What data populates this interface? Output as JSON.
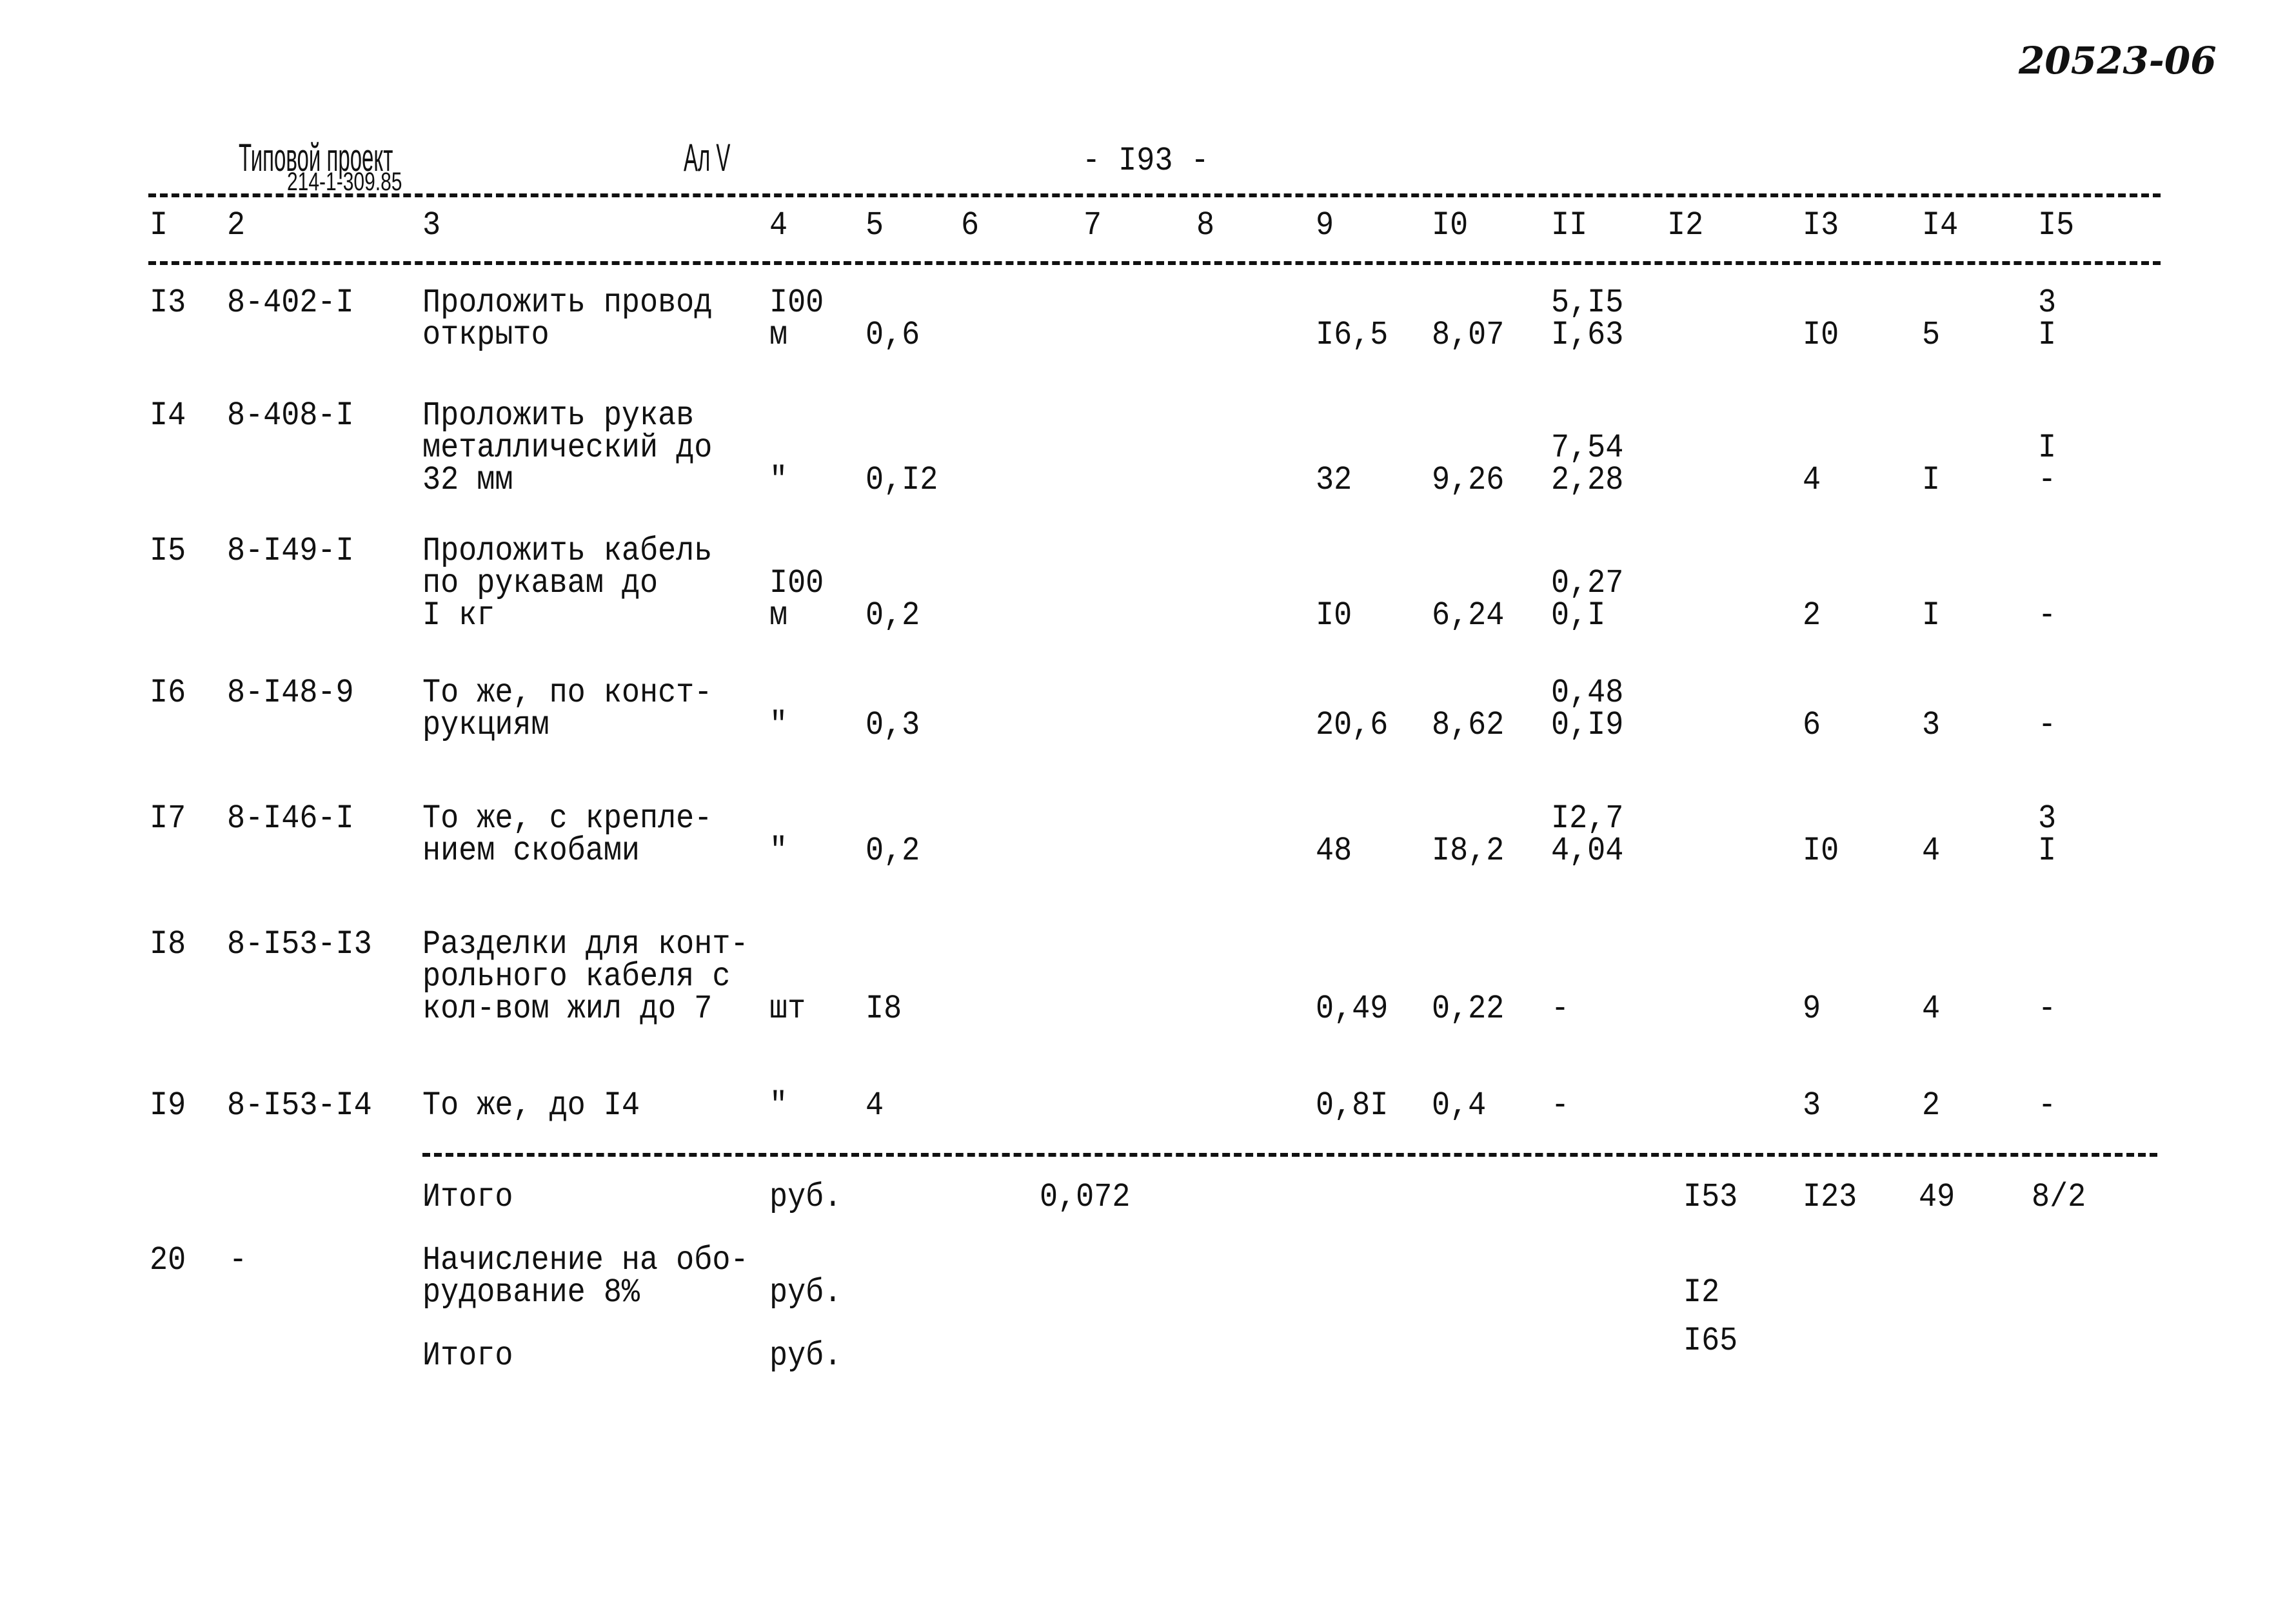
{
  "header": {
    "archive_number": "20523-06",
    "project_label": "Типовой проект",
    "project_number": "214-1-309.85",
    "album": "Ал V",
    "page": "- I93 -"
  },
  "columns": [
    "I",
    "2",
    "3",
    "4",
    "5",
    "6",
    "7",
    "8",
    "9",
    "I0",
    "II",
    "I2",
    "I3",
    "I4",
    "I5"
  ],
  "rows": [
    {
      "num": "I3",
      "code": "8-402-I",
      "desc": "Проложить провод\nоткрыто",
      "unit": "I00\nм",
      "qty": "0,6",
      "c9": "I6,5",
      "c10": "8,07",
      "c11": "5,I5\nI,63",
      "c13": "I0",
      "c14": "5",
      "c15": "3\nI"
    },
    {
      "num": "I4",
      "code": "8-408-I",
      "desc": "Проложить рукав\nметаллический до\n32 мм",
      "unit": "\"",
      "qty": "0,I2",
      "c9": "32",
      "c10": "9,26",
      "c11": "7,54\n2,28",
      "c13": "4",
      "c14": "I",
      "c15": "I\n-"
    },
    {
      "num": "I5",
      "code": "8-I49-I",
      "desc": "Проложить кабель\nпо рукавам до\nI кг",
      "unit": "I00\nм",
      "qty": "0,2",
      "c9": "I0",
      "c10": "6,24",
      "c11": "0,27\n0,I",
      "c13": "2",
      "c14": "I",
      "c15": "-"
    },
    {
      "num": "I6",
      "code": "8-I48-9",
      "desc": "То же, по конст-\nрукциям",
      "unit": "\"",
      "qty": "0,3",
      "c9": "20,6",
      "c10": "8,62",
      "c11": "0,48\n0,I9",
      "c13": "6",
      "c14": "3",
      "c15": "-"
    },
    {
      "num": "I7",
      "code": "8-I46-I",
      "desc": "То же, с крепле-\nнием скобами",
      "unit": "\"",
      "qty": "0,2",
      "c9": "48",
      "c10": "I8,2",
      "c11": "I2,7\n4,04",
      "c13": "I0",
      "c14": "4",
      "c15": "3\nI"
    },
    {
      "num": "I8",
      "code": "8-I53-I3",
      "desc": "Разделки для конт-\nрольного кабеля с\nкол-вом жил до 7",
      "unit": "шт",
      "qty": "I8",
      "c9": "0,49",
      "c10": "0,22",
      "c11": "-",
      "c13": "9",
      "c14": "4",
      "c15": "-"
    },
    {
      "num": "I9",
      "code": "8-I53-I4",
      "desc": "То же, до I4",
      "unit": "\"",
      "qty": "4",
      "c9": "0,8I",
      "c10": "0,4",
      "c11": "-",
      "c13": "3",
      "c14": "2",
      "c15": "-"
    }
  ],
  "totals": {
    "subtotal": {
      "label": "Итого",
      "unit": "руб.",
      "c7": "0,072",
      "c12": "I53",
      "c13": "I23",
      "c14": "49",
      "c15": "8/2"
    },
    "surcharge": {
      "num": "20",
      "code": "-",
      "label": "Начисление на обо-\nрудование 8%",
      "unit": "руб.",
      "c12": "I2"
    },
    "total": {
      "label": "Итого",
      "unit": "руб.",
      "c12": "I65"
    }
  }
}
